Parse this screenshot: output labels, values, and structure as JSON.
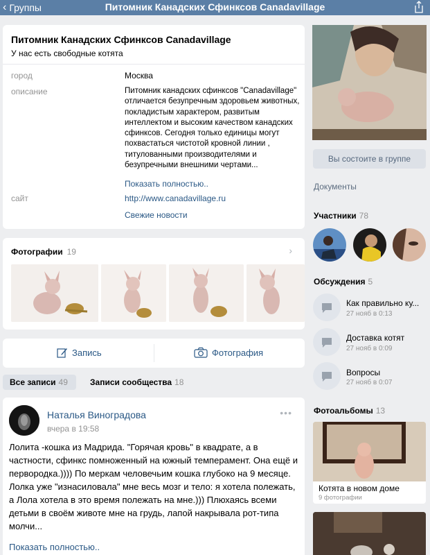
{
  "topbar": {
    "back_label": "Группы",
    "title": "Питомник Канадских Сфинксов Canadavillage"
  },
  "group": {
    "name": "Питомник Канадских Сфинксов Canadavillage",
    "status": "У нас есть свободные котята",
    "city_label": "город",
    "city": "Москва",
    "description_label": "описание",
    "description": "Питомник канадских сфинксов \"Canadavillage\" отличается безупречным здоровьем животных, покладистым характером, развитым интеллектом и высоким качеством канадских сфинксов. Сегодня только единицы могут похвастаться чистотой кровной линии , титулованными производителями и безупречными внешними чертами...",
    "show_more": "Показать полностью..",
    "site_label": "сайт",
    "site": "http://www.canadavillage.ru",
    "news_link": "Свежие новости"
  },
  "photos": {
    "title": "Фотографии",
    "count": "19"
  },
  "actions": {
    "post_label": "Запись",
    "photo_label": "Фотография"
  },
  "tabs": {
    "all_label": "Все записи",
    "all_count": "49",
    "community_label": "Записи сообщества",
    "community_count": "18"
  },
  "post": {
    "author": "Наталья Виноградова",
    "date": "вчера в 19:58",
    "text": "Лолита -кошка из Мадрида. \"Горячая кровь\" в квадрате, а в частности, сфинкс помноженный на южный темперамент. Она ещё и первородка.)))) По меркам человечьим кошка глубоко на 9 месяце. Лолка уже \"изнасиловала\" мне весь мозг и тело: я хотела полежать, а Лола хотела в это время полежать на мне.))) Плюхаясь всеми детьми в своём животе мне на грудь, лапой накрывала рот-типа молчи...",
    "show_more": "Показать полностью.."
  },
  "sidebar": {
    "member_button": "Вы состоите в группе",
    "documents": "Документы",
    "members_title": "Участники",
    "members_count": "78",
    "discussions_title": "Обсуждения",
    "discussions_count": "5",
    "discussions": [
      {
        "title": "Как правильно ку...",
        "date": "27 нояб в 0:13"
      },
      {
        "title": "Доставка котят",
        "date": "27 нояб в 0:09"
      },
      {
        "title": "Вопросы",
        "date": "27 нояб в 0:07"
      }
    ],
    "albums_title": "Фотоальбомы",
    "albums_count": "13",
    "album": {
      "title": "Котята в новом доме",
      "count": "9 фотографии"
    }
  },
  "colors": {
    "topbar": "#5b7fa6",
    "link": "#2a5885",
    "background": "#edeef0"
  }
}
